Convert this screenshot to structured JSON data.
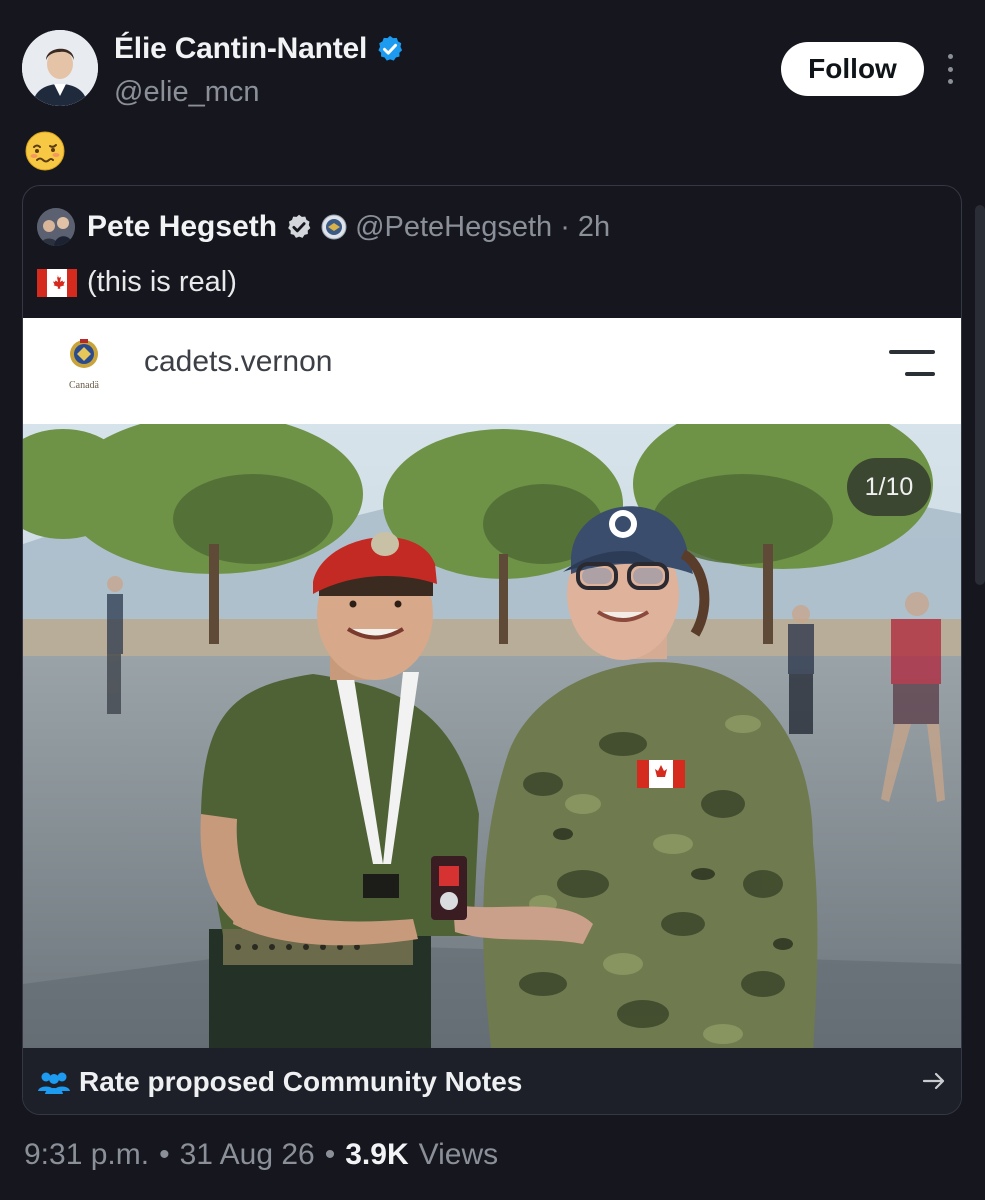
{
  "author": {
    "name": "Élie Cantin-Nantel",
    "handle": "@elie_mcn",
    "verified": true,
    "follow_label": "Follow"
  },
  "post": {
    "emoji": "woozy-face",
    "timestamp": "9:31 p.m.",
    "date": "31 Aug 26",
    "views_count": "3.9K",
    "views_label": "Views"
  },
  "quote": {
    "name": "Pete Hegseth",
    "handle": "@PeteHegseth",
    "age": "· 2h",
    "text": "(this is real)",
    "flag": "canada-flag"
  },
  "embed": {
    "site_name": "cadets.vernon",
    "logo_text": "Canadä",
    "image_counter": "1/10",
    "image_description": "Photo: cadet in green shirt and red beret receiving a medal from an officer in CADPAT uniform and cap"
  },
  "community_notes": {
    "label": "Rate proposed Community Notes"
  },
  "colors": {
    "background": "#15161e",
    "verified_blue": "#1d9bf0",
    "muted_text": "#8b8f98"
  }
}
